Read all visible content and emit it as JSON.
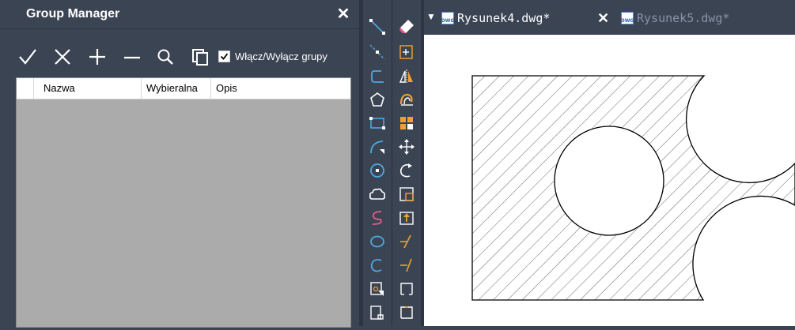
{
  "panel": {
    "title": "Group Manager",
    "close_label": "✕",
    "toolbar": [
      {
        "name": "confirm-icon",
        "glyph": "✓"
      },
      {
        "name": "cancel-icon",
        "glyph": "✕"
      },
      {
        "name": "add-icon",
        "glyph": "+"
      },
      {
        "name": "remove-icon",
        "glyph": "−"
      },
      {
        "name": "search-icon",
        "glyph": "search"
      },
      {
        "name": "copy-icon",
        "glyph": "copy"
      }
    ],
    "toggle": {
      "label": "Włącz/Wyłącz grupy",
      "checked": true
    },
    "table": {
      "columns": [
        "",
        "Nazwa",
        "Wybieralna",
        "Opis"
      ],
      "rows": []
    }
  },
  "tools_left": [
    "line-icon",
    "construction-line-icon",
    "polyline-icon",
    "polygon-icon",
    "rectangle-icon",
    "arc-icon",
    "circle-icon",
    "revision-cloud-icon",
    "spline-icon",
    "ellipse-icon",
    "ellipse-arc-icon",
    "insert-block-icon",
    "make-block-icon"
  ],
  "tools_right": [
    "erase-icon",
    "copy-tool-icon",
    "mirror-icon",
    "offset-icon",
    "array-icon",
    "move-icon",
    "rotate-icon",
    "scale-icon",
    "stretch-icon",
    "trim-icon",
    "extend-icon",
    "break-icon",
    "join-icon"
  ],
  "tabs": [
    {
      "label": "Rysunek4.dwg*",
      "active": true,
      "icon_text": "DWG"
    },
    {
      "label": "Rysunek5.dwg*",
      "active": false,
      "icon_text": "DWG"
    }
  ],
  "tab_close": "✕",
  "colors": {
    "panel_bg": "#3b4453",
    "grid_bg": "#ababab",
    "tool_accent": "#4fa8e0",
    "tool_orange": "#f0a030",
    "inactive_tab_text": "#8a93a3"
  }
}
